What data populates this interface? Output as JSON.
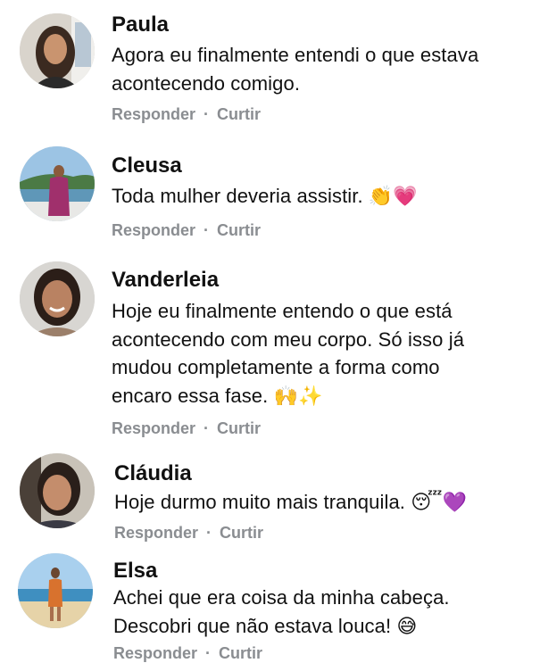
{
  "comments": [
    {
      "name": "Paula",
      "text": "Agora eu finalmente entendi o que estava acontecendo comigo.",
      "reply": "Responder",
      "dot": "·",
      "like": "Curtir"
    },
    {
      "name": "Cleusa",
      "text": "Toda mulher deveria assistir. 👏💗",
      "reply": "Responder",
      "dot": "·",
      "like": "Curtir"
    },
    {
      "name": "Vanderleia",
      "text": "Hoje eu finalmente entendo o que está acontecendo com meu corpo. Só isso já mudou completamente a forma como encaro essa fase. 🙌✨",
      "reply": "Responder",
      "dot": "·",
      "like": "Curtir"
    },
    {
      "name": "Cláudia",
      "text": "Hoje durmo muito mais tranquila. 😴💜",
      "reply": "Responder",
      "dot": "·",
      "like": "Curtir"
    },
    {
      "name": "Elsa",
      "text": "Achei que era coisa da minha cabeça. Descobri que não estava louca! 😅",
      "reply": "Responder",
      "dot": "·",
      "like": "Curtir"
    }
  ]
}
